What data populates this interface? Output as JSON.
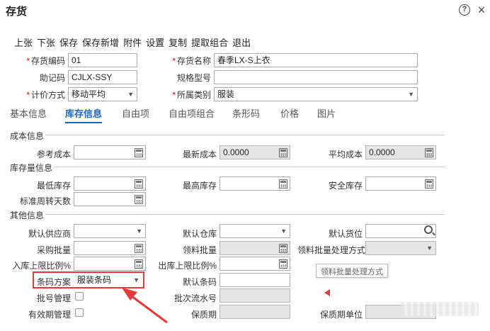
{
  "window": {
    "title": "存货"
  },
  "toolbar": [
    "上张",
    "下张",
    "保存",
    "保存新增",
    "附件",
    "设置",
    "复制",
    "提取组合",
    "退出"
  ],
  "header_fields": {
    "code_label": "存货编码",
    "code_value": "01",
    "name_label": "存货名称",
    "name_value": "春季LX-S上衣",
    "mnemonic_label": "助记码",
    "mnemonic_value": "CJLX-SSY",
    "spec_label": "规格型号",
    "spec_value": "",
    "pricing_label": "计价方式",
    "pricing_value": "移动平均",
    "category_label": "所属类别",
    "category_value": "服装"
  },
  "tabs": [
    "基本信息",
    "库存信息",
    "自由项",
    "自由项组合",
    "条形码",
    "价格",
    "图片"
  ],
  "active_tab": "库存信息",
  "sections": {
    "cost": "成本信息",
    "stock": "库存量信息",
    "other": "其他信息"
  },
  "cost": {
    "ref_cost_label": "参考成本",
    "ref_cost_value": "",
    "latest_cost_label": "最新成本",
    "latest_cost_value": "0.0000",
    "avg_cost_label": "平均成本",
    "avg_cost_value": "0.0000"
  },
  "stock": {
    "min_label": "最低库存",
    "max_label": "最高库存",
    "safe_label": "安全库存",
    "turnover_label": "标准周转天数"
  },
  "other": {
    "supplier_label": "默认供应商",
    "warehouse_label": "默认仓库",
    "location_label": "默认货位",
    "purchase_batch_label": "采购批量",
    "pick_batch_label": "领料批量",
    "pick_method_label": "领料批量处理方式",
    "in_limit_label": "入库上限比例%",
    "out_limit_label": "出库上限比例%",
    "barcode_scheme_label": "条码方案",
    "barcode_scheme_value": "服装条码",
    "default_barcode_label": "默认条码",
    "batch_mgmt_label": "批号管理",
    "batch_serial_label": "批次流水号",
    "expiry_mgmt_label": "有效期管理",
    "shelf_life_label": "保质期",
    "shelf_unit_label": "保质期单位"
  },
  "tooltip": "领料批量处理方式",
  "colors": {
    "accent": "#1a66b8",
    "annotation": "#e43a3a",
    "required": "#ee0000"
  }
}
